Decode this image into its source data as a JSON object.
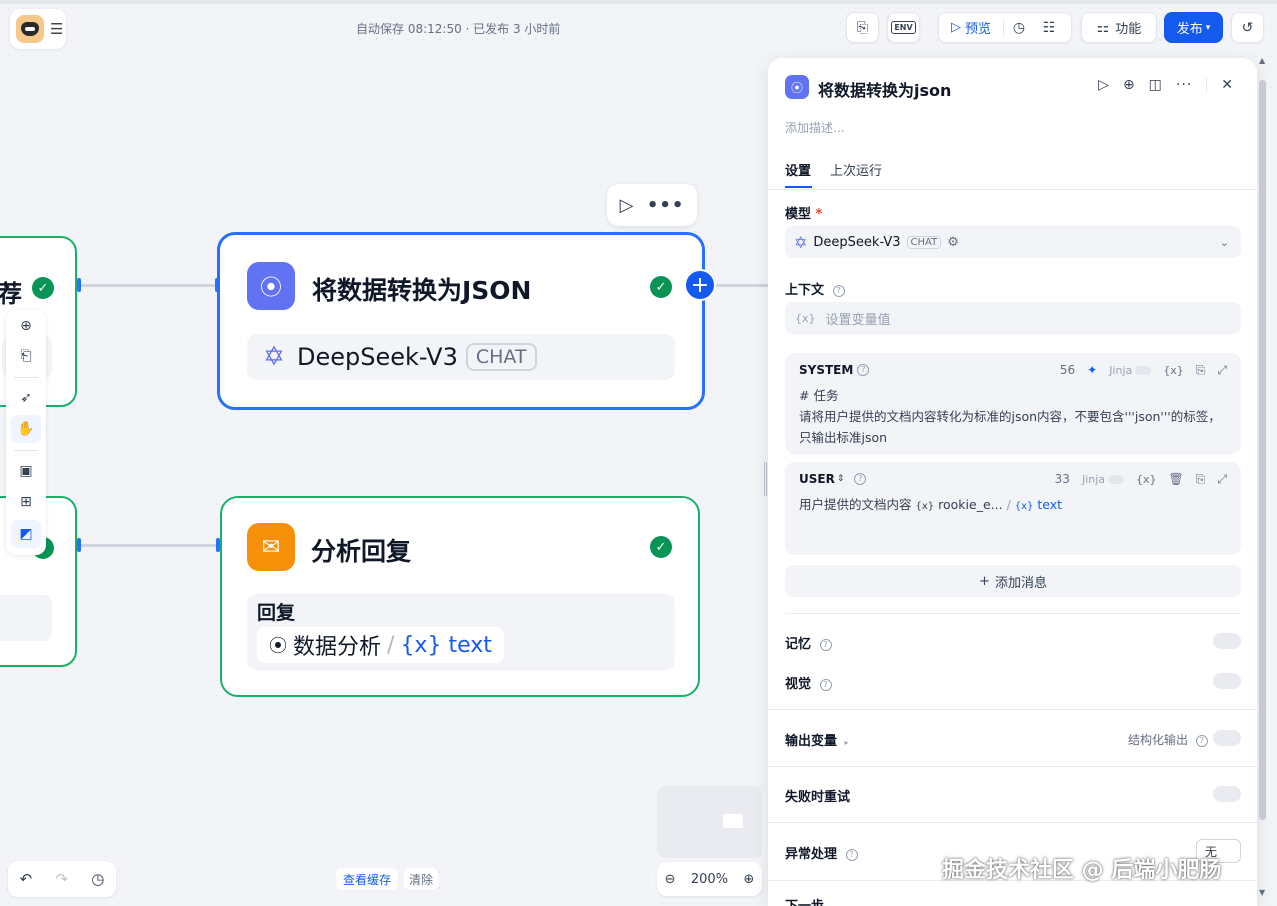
{
  "topbar": {
    "autosave": "自动保存 08:12:50 · 已发布 3 小时前",
    "env_label": "ENV",
    "preview_label": "预览",
    "features_label": "功能",
    "publish_label": "发布"
  },
  "canvas": {
    "left_node_top": {
      "title_fragment": "荐"
    },
    "llm_node": {
      "title": "将数据转换为JSON",
      "model": "DeepSeek-V3",
      "model_badge": "CHAT"
    },
    "answer_node": {
      "title": "分析回复",
      "reply_label": "回复",
      "var_source": "数据分析",
      "var_separator": "/",
      "var_name": "{x} text"
    },
    "zoom": "200%",
    "view_cache_label": "查看缓存",
    "clear_label": "清除"
  },
  "panel": {
    "title": "将数据转换为json",
    "description_placeholder": "添加描述...",
    "tabs": [
      {
        "label": "设置"
      },
      {
        "label": "上次运行"
      }
    ],
    "model_label": "模型",
    "required_mark": "*",
    "model_name": "DeepSeek-V3",
    "model_badge": "CHAT",
    "context_label": "上下文",
    "context_placeholder": "设置变量值",
    "context_prefix": "{x}",
    "system_prompt": {
      "role": "SYSTEM",
      "count": "56",
      "jinja": "Jinja",
      "line1": "# 任务",
      "line2": "请将用户提供的文档内容转化为标准的json内容，不要包含'''json'''的标签，只输出标准json"
    },
    "user_prompt": {
      "role": "USER",
      "count": "33",
      "jinja": "Jinja",
      "text": "用户提供的文档内容",
      "var1": "rookie_e...",
      "var_sep": "/",
      "var2": "text"
    },
    "add_message_label": "添加消息",
    "memory_label": "记忆",
    "vision_label": "视觉",
    "output_vars_label": "输出变量",
    "structured_output_label": "结构化输出",
    "retry_label": "失败时重试",
    "error_handling_label": "异常处理",
    "error_handling_value": "无",
    "next_label": "下一步"
  },
  "watermark": "掘金技术社区 @ 后端小肥肠",
  "colors": {
    "accent": "#155aef",
    "success": "#17b26a",
    "llm_icon": "#6172f3",
    "answer_icon": "#f79009"
  }
}
